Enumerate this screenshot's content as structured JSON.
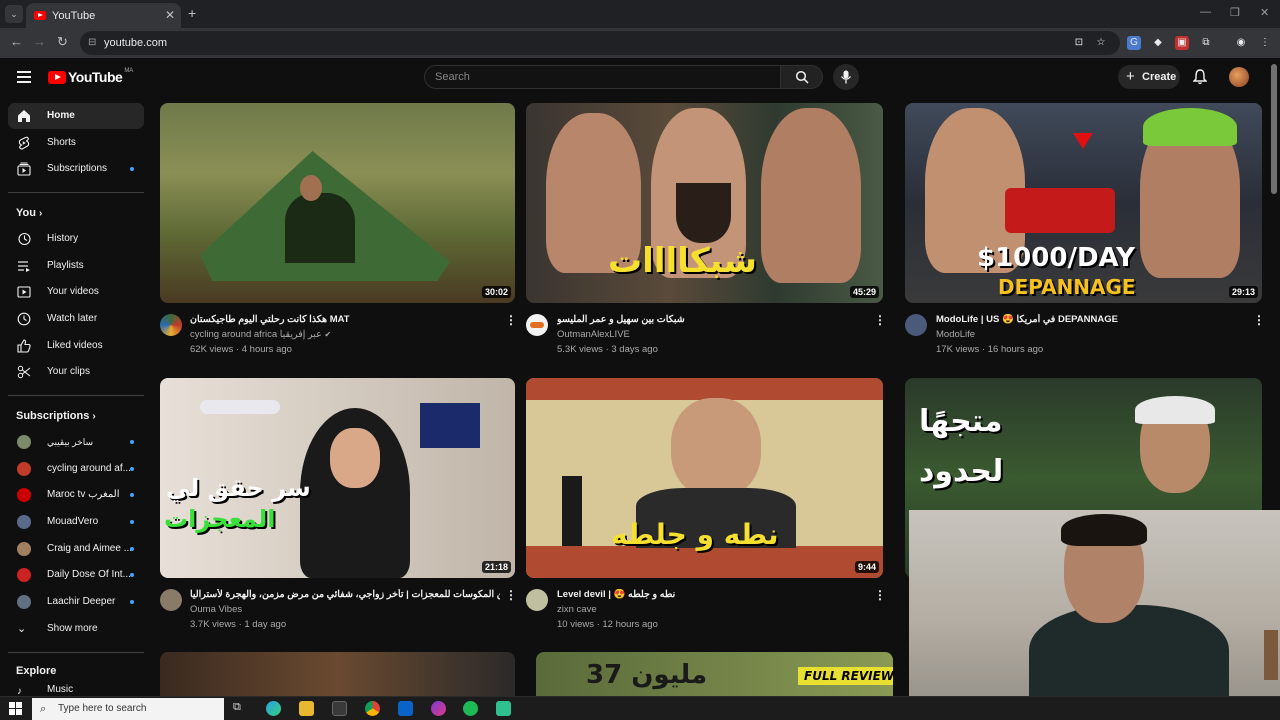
{
  "browser": {
    "tab_title": "YouTube",
    "url": "youtube.com"
  },
  "header": {
    "logo_text": "YouTube",
    "logo_country": "MA",
    "search_placeholder": "Search",
    "create_label": "Create"
  },
  "sidebar": {
    "main": [
      {
        "label": "Home",
        "icon": "home-icon",
        "active": true
      },
      {
        "label": "Shorts",
        "icon": "shorts-icon"
      },
      {
        "label": "Subscriptions",
        "icon": "subscriptions-icon",
        "dot": true
      }
    ],
    "you_heading": "You",
    "you": [
      {
        "label": "History",
        "icon": "history-icon"
      },
      {
        "label": "Playlists",
        "icon": "playlists-icon"
      },
      {
        "label": "Your videos",
        "icon": "your-videos-icon"
      },
      {
        "label": "Watch later",
        "icon": "watch-later-icon"
      },
      {
        "label": "Liked videos",
        "icon": "liked-icon"
      },
      {
        "label": "Your clips",
        "icon": "clips-icon"
      }
    ],
    "subs_heading": "Subscriptions",
    "subscriptions": [
      {
        "label": "ساخر بيقيبي",
        "color": "#7a8a6a"
      },
      {
        "label": "cycling around af...",
        "color": "#c23a2a"
      },
      {
        "label": "Maroc tv المغرب",
        "color": "#cc0000"
      },
      {
        "label": "MouadVero",
        "color": "#5a6a8a"
      },
      {
        "label": "Craig and Aimee ...",
        "color": "#a08060"
      },
      {
        "label": "Daily Dose Of Int...",
        "color": "#cc2222"
      },
      {
        "label": "Laachir Deeper",
        "color": "#607080"
      }
    ],
    "show_more": "Show more",
    "explore_heading": "Explore",
    "music_label": "Music"
  },
  "videos": [
    {
      "title": "هكذا كانت رحلتي اليوم طاجيكستان MAT",
      "channel": "cycling around africa عبر إفريقيا",
      "verified": true,
      "stats": "62K views · 4 hours ago",
      "duration": "30:02",
      "avatar_color": "#3a6a3a"
    },
    {
      "title": "شبكات بين سهيل و عمر المليسو",
      "channel": "OutmanAlexLIVE",
      "stats": "5.3K views · 3 days ago",
      "duration": "45:29",
      "overlay": "شبكاااات",
      "avatar_color": "#e07020"
    },
    {
      "title": "ModoLife | US 😍 في أمريكا DEPANNAGE",
      "channel": "ModoLife",
      "stats": "17K views · 16 hours ago",
      "duration": "29:13",
      "overlay": "$1000/DAY",
      "overlay2": "DEPANNAGE",
      "avatar_color": "#4a5a7a"
    },
    {
      "title": "من المكوسات للمعجزات | تأخر زواجي، شفائي من مرض مزمن، والهجرة لأستراليا AU",
      "channel": "Ouma Vibes",
      "stats": "3.7K views · 1 day ago",
      "duration": "21:18",
      "overlay": "سر حقق لي",
      "overlay2": "المعجزات",
      "avatar_color": "#8a7a6a"
    },
    {
      "title": "Level devil | 😍 نطه و جلطه",
      "channel": "zixn cave",
      "stats": "10 views · 12 hours ago",
      "duration": "9:44",
      "overlay": "نطه و جلطه",
      "avatar_color": "#c0c0a0"
    },
    {
      "overlay": "متجهًا",
      "overlay2": "لحدود"
    },
    {
      "overlay": "37 مليون"
    },
    {
      "overlay": "FULL REVIEW"
    }
  ],
  "taskbar": {
    "search_placeholder": "Type here to search"
  }
}
